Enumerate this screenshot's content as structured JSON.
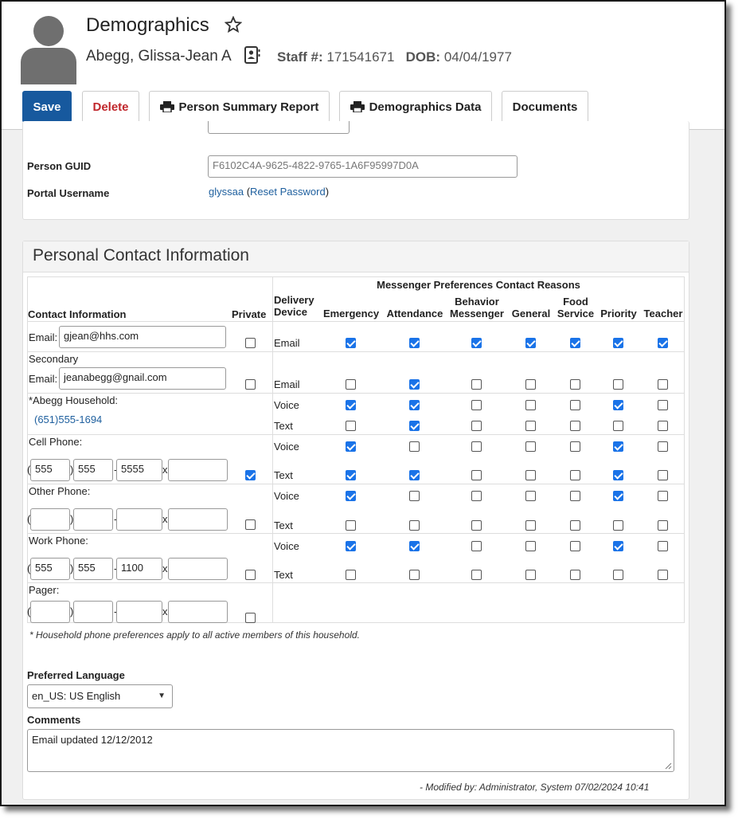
{
  "header": {
    "title": "Demographics",
    "person_name": "Abegg, Glissa-Jean A",
    "staff_label": "Staff #:",
    "staff_number": "171541671",
    "dob_label": "DOB:",
    "dob": "04/04/1977"
  },
  "toolbar": {
    "save": "Save",
    "delete": "Delete",
    "person_summary": "Person Summary Report",
    "demographics_data": "Demographics Data",
    "documents": "Documents"
  },
  "identity": {
    "guid_label": "Person GUID",
    "guid_value": "F6102C4A-9625-4822-9765-1A6F95997D0A",
    "portal_label": "Portal Username",
    "portal_username": "glyssaa",
    "reset_password": "Reset Password",
    "paren_open": "(",
    "paren_close": ")"
  },
  "contact": {
    "section_title": "Personal Contact Information",
    "col_contact": "Contact Information",
    "col_private": "Private",
    "messenger_header": "Messenger Preferences Contact Reasons",
    "col_device": "Delivery Device",
    "reasons": [
      "Emergency",
      "Attendance",
      "Behavior Messenger",
      "General",
      "Food Service",
      "Priority",
      "Teacher"
    ],
    "email_label": "Email:",
    "email_value": "gjean@hhs.com",
    "secondary_label": "Secondary",
    "secondary_email_label": "Email:",
    "secondary_email_value": "jeanabegg@gnail.com",
    "household_label": "*Abegg Household:",
    "household_phone": "(651)555-1694",
    "cell_label": "Cell Phone:",
    "cell": {
      "area": "555",
      "prefix": "555",
      "line": "5555",
      "ext": ""
    },
    "other_label": "Other Phone:",
    "other": {
      "area": "",
      "prefix": "",
      "line": "",
      "ext": ""
    },
    "work_label": "Work Phone:",
    "work": {
      "area": "555",
      "prefix": "555",
      "line": "1100",
      "ext": ""
    },
    "pager_label": "Pager:",
    "pager": {
      "area": "",
      "prefix": "",
      "line": "",
      "ext": ""
    },
    "phone_symbols": {
      "open": "(",
      "close": ")",
      "dash": "-",
      "x": "x"
    },
    "private": {
      "email": false,
      "secondary": false,
      "cell": true,
      "other": false,
      "work": false,
      "pager": false
    },
    "device_rows": [
      {
        "device": "Email",
        "checks": [
          true,
          true,
          true,
          true,
          true,
          true,
          true
        ]
      },
      {
        "device": "Email",
        "checks": [
          false,
          true,
          false,
          false,
          false,
          false,
          false
        ]
      },
      {
        "device": "Voice",
        "checks": [
          true,
          true,
          false,
          false,
          false,
          true,
          false
        ]
      },
      {
        "device": "Text",
        "checks": [
          false,
          true,
          false,
          false,
          false,
          false,
          false
        ]
      },
      {
        "device": "Voice",
        "checks": [
          true,
          false,
          false,
          false,
          false,
          true,
          false
        ]
      },
      {
        "device": "Text",
        "checks": [
          true,
          true,
          false,
          false,
          false,
          true,
          false
        ]
      },
      {
        "device": "Voice",
        "checks": [
          true,
          false,
          false,
          false,
          false,
          true,
          false
        ]
      },
      {
        "device": "Text",
        "checks": [
          false,
          false,
          false,
          false,
          false,
          false,
          false
        ]
      },
      {
        "device": "Voice",
        "checks": [
          true,
          true,
          false,
          false,
          false,
          true,
          false
        ]
      },
      {
        "device": "Text",
        "checks": [
          false,
          false,
          false,
          false,
          false,
          false,
          false
        ]
      }
    ],
    "household_note": "* Household phone preferences apply to all active members of this household.",
    "language_label": "Preferred Language",
    "language_value": "en_US: US English",
    "comments_label": "Comments",
    "comments_value": "Email updated 12/12/2012",
    "modified": "- Modified by: Administrator, System 07/02/2024 10:41"
  },
  "icons": {
    "star": "star-outline-icon",
    "contact_card": "contact-card-icon",
    "printer": "printer-icon",
    "dropdown": "dropdown-arrow-icon",
    "resize": "resize-handle-icon"
  }
}
